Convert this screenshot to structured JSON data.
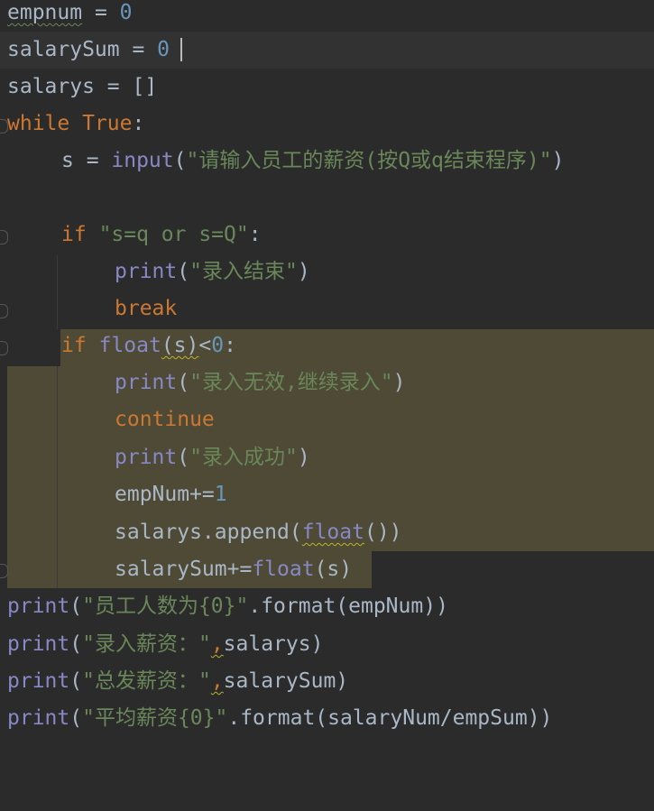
{
  "editor": {
    "lines": {
      "l1": "empnum = 0",
      "l2": "salarySum = 0",
      "l3": "salarys = []",
      "l4_kw": "while",
      "l4_true": "True",
      "l4_colon": ":",
      "l5_pre": "s = ",
      "l5_fn": "input",
      "l5_str": "\"请输入员工的薪资(按Q或q结束程序)\"",
      "l7_kw": "if",
      "l7_str": "\"s=q or s=Q\"",
      "l8_fn": "print",
      "l8_str": "\"录入结束\"",
      "l9_kw": "break",
      "l10_kw": "if",
      "l10_fn": "float",
      "l10_arg": "(s)",
      "l10_op": "<",
      "l10_num": "0",
      "l10_colon": ":",
      "l11_fn": "print",
      "l11_str": "\"录入无效,继续录入\"",
      "l12_kw": "continue",
      "l13_fn": "print",
      "l13_str": "\"录入成功\"",
      "l14_pre": "empNum+=",
      "l14_num": "1",
      "l15_pre": "salarys.append(",
      "l15_fn": "float",
      "l15_post": "())",
      "l16_pre": "salarySum+=",
      "l16_fn": "float",
      "l16_post": "(s)",
      "l17_fn": "print",
      "l17_str": "\"员工人数为{0}\"",
      "l17_post": ".format(empNum))",
      "l18_fn": "print",
      "l18_str": "\"录入薪资：\"",
      "l18_comma": ",",
      "l18_post": "salarys)",
      "l19_fn": "print",
      "l19_str": "\"总发薪资：\"",
      "l19_comma": ",",
      "l19_post": "salarySum)",
      "l20_fn": "print",
      "l20_str": "\"平均薪资{0}\"",
      "l20_post": ".format(salaryNum/empSum))"
    }
  },
  "colors": {
    "background": "#2b2b2b",
    "keyword": "#cc7832",
    "string": "#6a8759",
    "number": "#6897bb",
    "builtin": "#8888c6",
    "selection": "#4e4a35"
  }
}
